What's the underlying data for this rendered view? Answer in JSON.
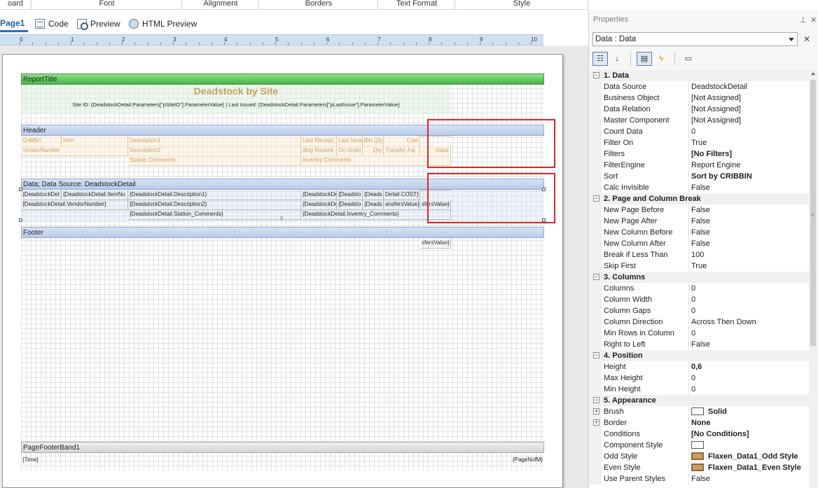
{
  "ribbon": {
    "groups": [
      {
        "label": "oard",
        "launcher": false
      },
      {
        "label": "Font",
        "launcher": false
      },
      {
        "label": "Alignment",
        "launcher": false
      },
      {
        "label": "Borders",
        "launcher": true
      },
      {
        "label": "Text Format",
        "launcher": false
      },
      {
        "label": "Style",
        "launcher": true
      }
    ]
  },
  "tabs": [
    {
      "label": "Page1",
      "icon": "none"
    },
    {
      "label": "Code",
      "icon": "code-icon"
    },
    {
      "label": "Preview",
      "icon": "preview-icon"
    },
    {
      "label": "HTML Preview",
      "icon": "globe-icon"
    }
  ],
  "ruler": {
    "marks": [
      "0",
      "1",
      "2",
      "3",
      "4",
      "5",
      "6",
      "7",
      "8",
      "9",
      "10"
    ]
  },
  "report": {
    "title_band": {
      "name": "ReportTitle",
      "title": "Deadstock by Site",
      "subtitle": "Site ID:  {DeadstockDetail.Parameters[\"pSiteID\"].ParameterValue}  |  Last Issued:  {DeadstockDetail.Parameters[\"pLastIssue\"].ParameterValue}"
    },
    "header_band": {
      "name": "Header",
      "row1": [
        "CribBin",
        "Item",
        "Description1",
        "Last Receipt",
        "Last Issue",
        "Bin Qty",
        "Cost"
      ],
      "row2": [
        "VendorNumber",
        "Description2",
        "ding Rework",
        "On Order",
        "Qty",
        "Transfer Adj",
        "Value"
      ],
      "row3": [
        "Station Comments",
        "Inventry Comments"
      ]
    },
    "data_band": {
      "name": "Data; Data Source: DeadstockDetail",
      "row1": [
        "{DeadstockDet",
        "{DeadstockDetail.ItemNu",
        "{DeadstockDetail.Description1}",
        "{DeadstockDe",
        "{Deadsto",
        "{Deads",
        "Detail.COST}"
      ],
      "row2": [
        "{DeadstockDetail.VendorNumber}",
        "{DeadstockDetail.Description2}",
        "{DeadstockDe",
        "{Deadsto",
        "{Deads",
        "ansfersValue}",
        "sfersValue}"
      ],
      "row3": [
        "{DeadstockDetail.Station_Comments}",
        "{DeadstockDetail.Inventry_Comments}"
      ]
    },
    "footer_band": {
      "name": "Footer",
      "value": "sfersValue}"
    },
    "page_footer_band": {
      "name": "PageFooterBand1",
      "left": "{Time}",
      "right": "{PageNofM}"
    }
  },
  "properties": {
    "title": "Properties",
    "pin_icon": "pin-icon",
    "component": "Data : Data",
    "toolbar": [
      "categorized-icon",
      "alphabetical-icon",
      "properties-icon",
      "events-icon",
      "component-icon"
    ],
    "categories": [
      {
        "name": "1. Data",
        "rows": [
          {
            "name": "Data Source",
            "value": "DeadstockDetail"
          },
          {
            "name": "Business Object",
            "value": "[Not Assigned]"
          },
          {
            "name": "Data Relation",
            "value": "[Not Assigned]"
          },
          {
            "name": "Master Component",
            "value": "[Not Assigned]"
          },
          {
            "name": "Count Data",
            "value": "0"
          },
          {
            "name": "Filter On",
            "value": "True"
          },
          {
            "name": "Filters",
            "value": "[No Filters]",
            "bold": true
          },
          {
            "name": "FilterEngine",
            "value": "Report Engine"
          },
          {
            "name": "Sort",
            "value": "Sort by CRIBBIN",
            "bold": true
          },
          {
            "name": "Calc Invisible",
            "value": "False"
          }
        ]
      },
      {
        "name": "2. Page and  Column  Break",
        "rows": [
          {
            "name": "New Page Before",
            "value": "False"
          },
          {
            "name": "New Page After",
            "value": "False"
          },
          {
            "name": "New Column Before",
            "value": "False"
          },
          {
            "name": "New Column After",
            "value": "False"
          },
          {
            "name": "Break if Less Than",
            "value": "100"
          },
          {
            "name": "Skip First",
            "value": "True"
          }
        ]
      },
      {
        "name": "3. Columns",
        "rows": [
          {
            "name": "Columns",
            "value": "0"
          },
          {
            "name": "Column Width",
            "value": "0"
          },
          {
            "name": "Column Gaps",
            "value": "0"
          },
          {
            "name": "Column Direction",
            "value": "Across Then Down"
          },
          {
            "name": "Min Rows in Column",
            "value": "0"
          },
          {
            "name": "Right to Left",
            "value": "False"
          }
        ]
      },
      {
        "name": "4. Position",
        "rows": [
          {
            "name": "Height",
            "value": "0,6",
            "bold": true
          },
          {
            "name": "Max Height",
            "value": "0"
          },
          {
            "name": "Min Height",
            "value": "0"
          }
        ]
      },
      {
        "name": "5. Appearance",
        "rows": [
          {
            "name": "Brush",
            "value": "Solid",
            "bold": true,
            "expand": true,
            "swatch": "white"
          },
          {
            "name": "Border",
            "value": "None",
            "bold": true,
            "expand": true
          },
          {
            "name": "Conditions",
            "value": "[No Conditions]",
            "bold": true
          },
          {
            "name": "Component Style",
            "value": "",
            "swatch": "white"
          },
          {
            "name": "Odd Style",
            "value": "Flaxen_Data1_Odd Style",
            "bold": true,
            "swatch": "gold"
          },
          {
            "name": "Even Style",
            "value": "Flaxen_Data1_Even Style",
            "bold": true,
            "swatch": "gold"
          },
          {
            "name": "Use Parent Styles",
            "value": "False"
          }
        ]
      }
    ]
  }
}
